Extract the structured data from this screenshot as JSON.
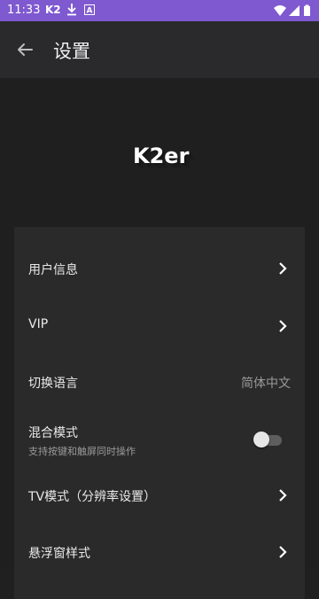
{
  "status_bar": {
    "time": "11:33",
    "app_badge": "K2",
    "download_icon": "download-icon",
    "text_icon": "A",
    "bg_color": "#7f59cf"
  },
  "app_bar": {
    "title": "设置",
    "back_icon": "back-arrow-icon"
  },
  "logo": {
    "text": "K2er"
  },
  "settings": {
    "user_info": {
      "label": "用户信息"
    },
    "vip": {
      "label": "VIP"
    },
    "language": {
      "label": "切换语言",
      "value": "简体中文"
    },
    "mixed_mode": {
      "label": "混合模式",
      "sublabel": "支持按键和触屏同时操作",
      "enabled": false
    },
    "tv_mode": {
      "label": "TV模式（分辨率设置）"
    },
    "floating_window": {
      "label": "悬浮窗样式"
    }
  }
}
